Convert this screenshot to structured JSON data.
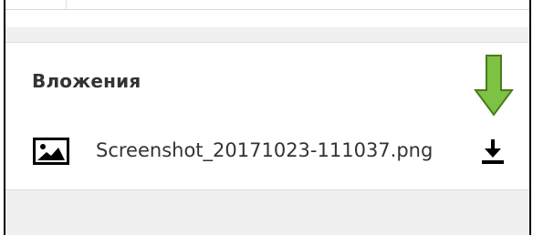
{
  "attachments_section": {
    "title": "Вложения",
    "items": [
      {
        "file_name": "Screenshot_20171023-111037.png",
        "file_type_icon": "image-icon",
        "action_icon": "download-icon"
      }
    ]
  },
  "annotation": {
    "icon": "green-arrow-down-icon",
    "color": "#7dc242"
  }
}
